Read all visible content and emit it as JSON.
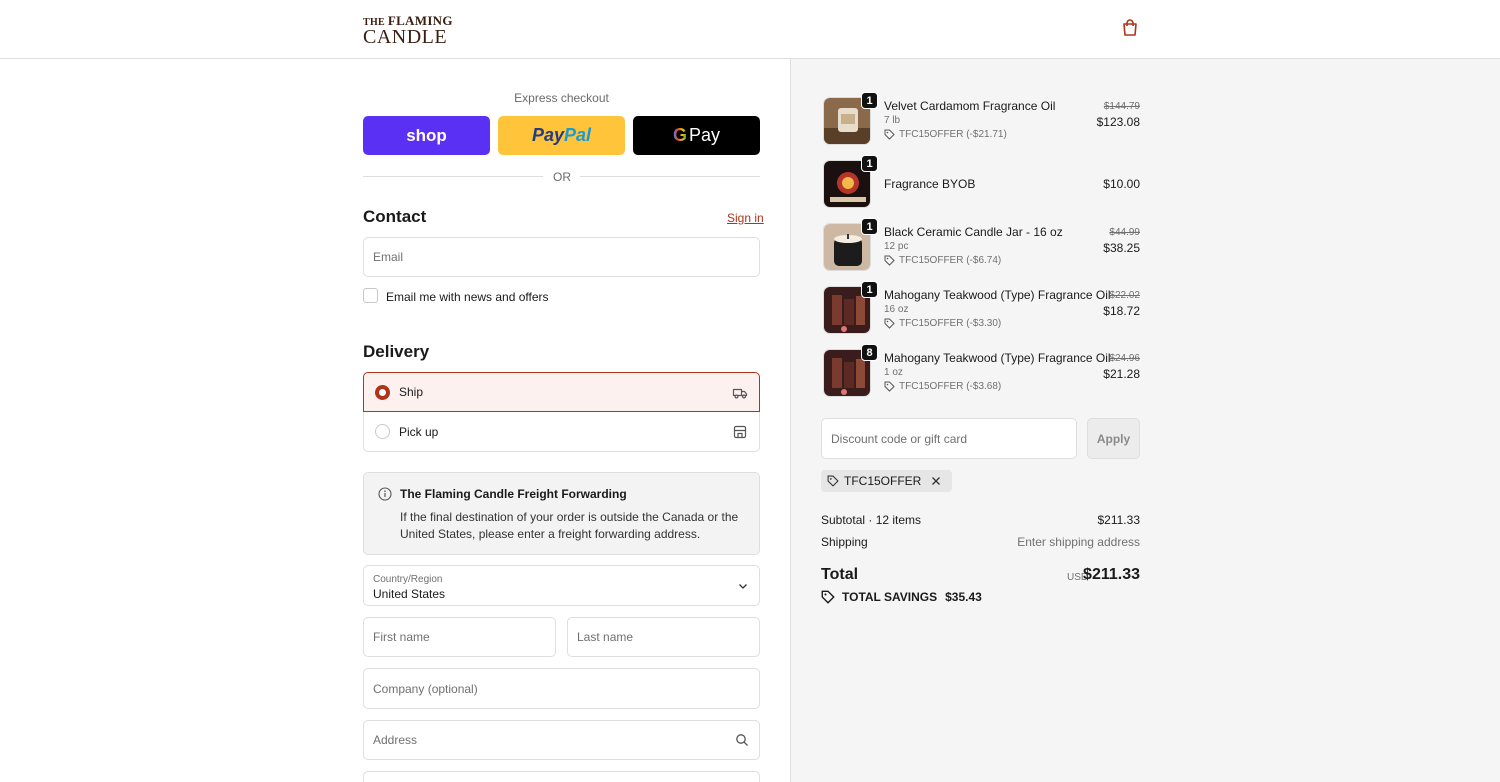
{
  "brand": {
    "line1_small": "THE",
    "line1_big": "FLAMING",
    "line2": "CANDLE"
  },
  "express": {
    "title": "Express checkout",
    "shop_label": "shop",
    "paypal_label_1": "Pay",
    "paypal_label_2": "Pal",
    "gpay_g": "G",
    "gpay_label": "Pay",
    "or_label": "OR"
  },
  "contact": {
    "heading": "Contact",
    "signin": "Sign in",
    "email_placeholder": "Email",
    "news_label": "Email me with news and offers"
  },
  "delivery": {
    "heading": "Delivery",
    "options": [
      {
        "label": "Ship",
        "selected": true
      },
      {
        "label": "Pick up",
        "selected": false
      }
    ],
    "notice_title": "The Flaming Candle Freight Forwarding",
    "notice_body": "If the final destination of your order is outside the Canada or the United States, please enter a freight forwarding address.",
    "country_label": "Country/Region",
    "country_value": "United States",
    "first_name": "First name",
    "last_name": "Last name",
    "company": "Company (optional)",
    "address": "Address"
  },
  "colors": {
    "accent": "#b0341b",
    "shop": "#5a31f4",
    "paypal": "#ffc439"
  },
  "items": [
    {
      "qty": "1",
      "name": "Velvet Cardamom Fragrance Oil",
      "variant": "7 lb",
      "discount": "TFC15OFFER (-$21.71)",
      "old_price": "$144.79",
      "price": "$123.08"
    },
    {
      "qty": "1",
      "name": "Fragrance BYOB",
      "variant": "",
      "discount": "",
      "old_price": "",
      "price": "$10.00"
    },
    {
      "qty": "1",
      "name": "Black Ceramic Candle Jar - 16 oz",
      "variant": "12 pc",
      "discount": "TFC15OFFER (-$6.74)",
      "old_price": "$44.99",
      "price": "$38.25"
    },
    {
      "qty": "1",
      "name": "Mahogany Teakwood (Type) Fragrance Oil",
      "variant": "16 oz",
      "discount": "TFC15OFFER (-$3.30)",
      "old_price": "$22.02",
      "price": "$18.72"
    },
    {
      "qty": "8",
      "name": "Mahogany Teakwood (Type) Fragrance Oil",
      "variant": "1 oz",
      "discount": "TFC15OFFER (-$3.68)",
      "old_price": "$24.96",
      "price": "$21.28"
    }
  ],
  "summary": {
    "discount_placeholder": "Discount code or gift card",
    "apply": "Apply",
    "applied_code": "TFC15OFFER",
    "subtotal_label": "Subtotal · 12 items",
    "subtotal_value": "$211.33",
    "shipping_label": "Shipping",
    "shipping_value": "Enter shipping address",
    "total_label": "Total",
    "currency": "USD",
    "total_value": "$211.33",
    "savings_label": "TOTAL SAVINGS",
    "savings_value": "$35.43"
  }
}
